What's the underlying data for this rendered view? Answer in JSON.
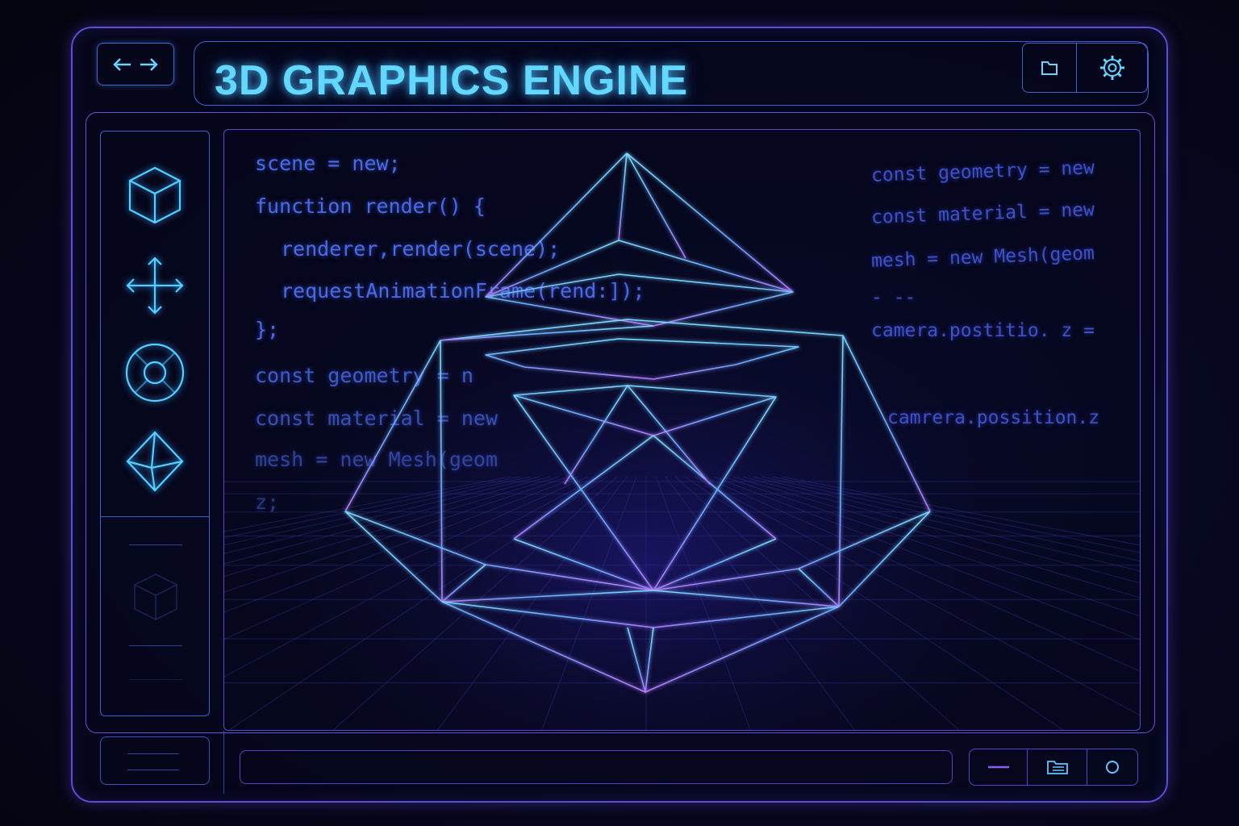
{
  "header": {
    "title": "3D GRAPHICS ENGINE",
    "nav_icon": "arrows-left-right-icon",
    "tools": [
      "folder-icon",
      "gear-icon"
    ]
  },
  "sidebar": {
    "tools": [
      "cube-icon",
      "move-icon",
      "ring-icon",
      "octahedron-icon"
    ],
    "secondary": [
      "faded-cube-icon"
    ]
  },
  "code_left": [
    "scene = new;",
    "function render() {",
    "  renderer,render(scene);",
    "  requestAnimationFrame(rend:]);",
    "};",
    "const geometry = n",
    "const material = new",
    "mesh = new Mesh(geom",
    "z;"
  ],
  "code_right": [
    "const geometry = new",
    "const material = new",
    "mesh = new Mesh(geom",
    "- --",
    "camera.postitio. z =",
    "camrera.possition.z"
  ],
  "footer": {
    "controls": [
      "minus-icon",
      "folder-icon",
      "circle-icon"
    ]
  },
  "colors": {
    "accent_cyan": "#62d8ff",
    "wire_blue": "#6fc8ff",
    "frame_purple": "#6a4fe0"
  }
}
